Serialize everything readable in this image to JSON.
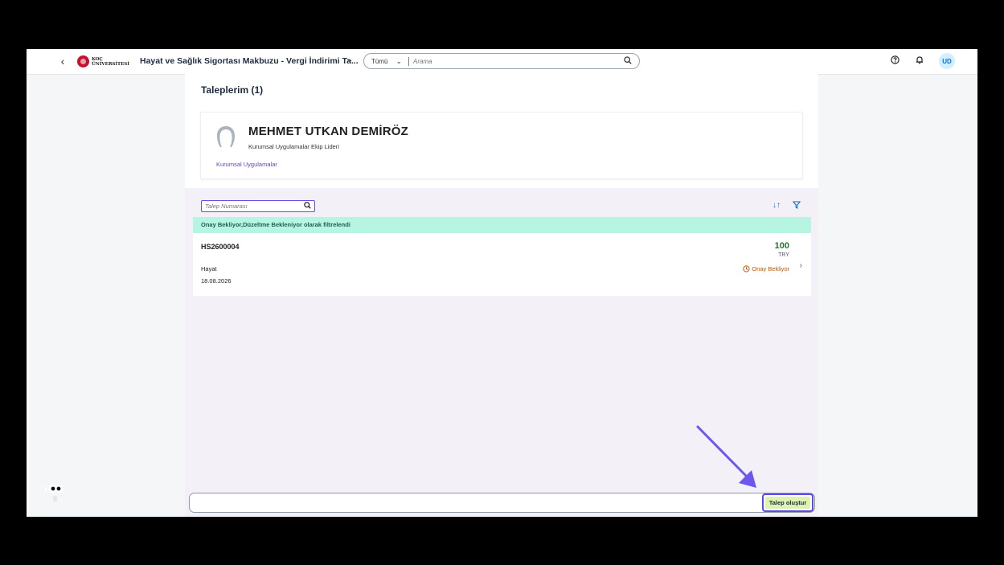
{
  "shell": {
    "logo_line1": "KOÇ",
    "logo_line2": "ÜNİVERSİTESİ",
    "app_title": "Hayat ve Sağlık Sigortası Makbuzu - Vergi İndirimi Ta...",
    "search_scope": "Tümü",
    "search_placeholder": "Arama",
    "avatar_initials": "UD"
  },
  "page": {
    "title": "Taleplerim (1)"
  },
  "profile": {
    "name": "MEHMET UTKAN DEMİRÖZ",
    "role": "Kurumsal Uygulamalar Ekip Lideri",
    "department": "Kurumsal Uygulamalar"
  },
  "list": {
    "filter_placeholder": "Talep Numarası",
    "info_strip": "Onay Bekliyor,Düzeltme Bekleniyor olarak filtrelendi",
    "items": [
      {
        "id": "HS2600004",
        "type": "Hayat",
        "date": "18.08.2026",
        "amount": "100",
        "currency": "TRY",
        "status": "Onay Bekliyor"
      }
    ]
  },
  "footer": {
    "create_label": "Talep oluştur"
  },
  "colors": {
    "accent": "#5b49e8",
    "status_pending": "#c35500",
    "amount": "#256f3a",
    "info_strip_bg": "#b7f5e3",
    "create_button_bg": "#dff3b0"
  }
}
